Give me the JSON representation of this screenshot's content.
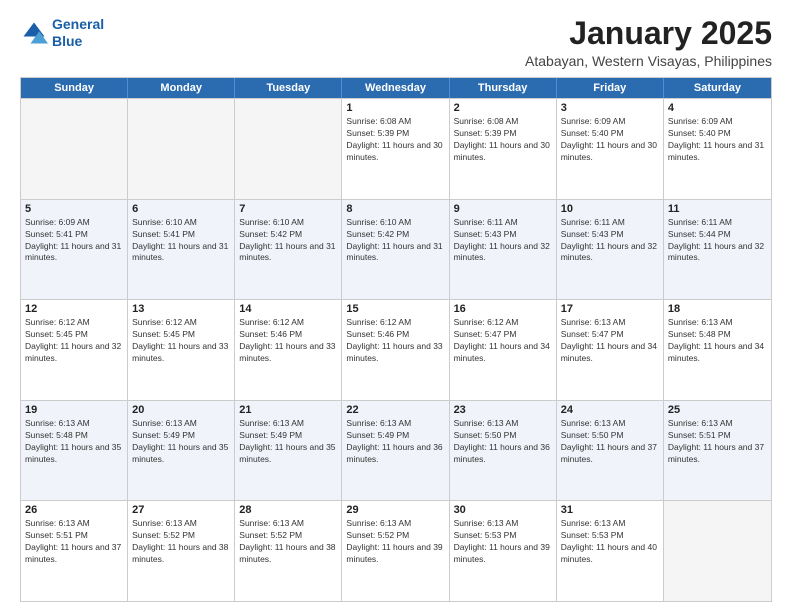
{
  "logo": {
    "line1": "General",
    "line2": "Blue"
  },
  "title": "January 2025",
  "subtitle": "Atabayan, Western Visayas, Philippines",
  "days": [
    "Sunday",
    "Monday",
    "Tuesday",
    "Wednesday",
    "Thursday",
    "Friday",
    "Saturday"
  ],
  "weeks": [
    [
      {
        "num": "",
        "empty": true
      },
      {
        "num": "",
        "empty": true
      },
      {
        "num": "",
        "empty": true
      },
      {
        "num": "1",
        "sunrise": "6:08 AM",
        "sunset": "5:39 PM",
        "daylight": "11 hours and 30 minutes."
      },
      {
        "num": "2",
        "sunrise": "6:08 AM",
        "sunset": "5:39 PM",
        "daylight": "11 hours and 30 minutes."
      },
      {
        "num": "3",
        "sunrise": "6:09 AM",
        "sunset": "5:40 PM",
        "daylight": "11 hours and 30 minutes."
      },
      {
        "num": "4",
        "sunrise": "6:09 AM",
        "sunset": "5:40 PM",
        "daylight": "11 hours and 31 minutes."
      }
    ],
    [
      {
        "num": "5",
        "sunrise": "6:09 AM",
        "sunset": "5:41 PM",
        "daylight": "11 hours and 31 minutes."
      },
      {
        "num": "6",
        "sunrise": "6:10 AM",
        "sunset": "5:41 PM",
        "daylight": "11 hours and 31 minutes."
      },
      {
        "num": "7",
        "sunrise": "6:10 AM",
        "sunset": "5:42 PM",
        "daylight": "11 hours and 31 minutes."
      },
      {
        "num": "8",
        "sunrise": "6:10 AM",
        "sunset": "5:42 PM",
        "daylight": "11 hours and 31 minutes."
      },
      {
        "num": "9",
        "sunrise": "6:11 AM",
        "sunset": "5:43 PM",
        "daylight": "11 hours and 32 minutes."
      },
      {
        "num": "10",
        "sunrise": "6:11 AM",
        "sunset": "5:43 PM",
        "daylight": "11 hours and 32 minutes."
      },
      {
        "num": "11",
        "sunrise": "6:11 AM",
        "sunset": "5:44 PM",
        "daylight": "11 hours and 32 minutes."
      }
    ],
    [
      {
        "num": "12",
        "sunrise": "6:12 AM",
        "sunset": "5:45 PM",
        "daylight": "11 hours and 32 minutes."
      },
      {
        "num": "13",
        "sunrise": "6:12 AM",
        "sunset": "5:45 PM",
        "daylight": "11 hours and 33 minutes."
      },
      {
        "num": "14",
        "sunrise": "6:12 AM",
        "sunset": "5:46 PM",
        "daylight": "11 hours and 33 minutes."
      },
      {
        "num": "15",
        "sunrise": "6:12 AM",
        "sunset": "5:46 PM",
        "daylight": "11 hours and 33 minutes."
      },
      {
        "num": "16",
        "sunrise": "6:12 AM",
        "sunset": "5:47 PM",
        "daylight": "11 hours and 34 minutes."
      },
      {
        "num": "17",
        "sunrise": "6:13 AM",
        "sunset": "5:47 PM",
        "daylight": "11 hours and 34 minutes."
      },
      {
        "num": "18",
        "sunrise": "6:13 AM",
        "sunset": "5:48 PM",
        "daylight": "11 hours and 34 minutes."
      }
    ],
    [
      {
        "num": "19",
        "sunrise": "6:13 AM",
        "sunset": "5:48 PM",
        "daylight": "11 hours and 35 minutes."
      },
      {
        "num": "20",
        "sunrise": "6:13 AM",
        "sunset": "5:49 PM",
        "daylight": "11 hours and 35 minutes."
      },
      {
        "num": "21",
        "sunrise": "6:13 AM",
        "sunset": "5:49 PM",
        "daylight": "11 hours and 35 minutes."
      },
      {
        "num": "22",
        "sunrise": "6:13 AM",
        "sunset": "5:49 PM",
        "daylight": "11 hours and 36 minutes."
      },
      {
        "num": "23",
        "sunrise": "6:13 AM",
        "sunset": "5:50 PM",
        "daylight": "11 hours and 36 minutes."
      },
      {
        "num": "24",
        "sunrise": "6:13 AM",
        "sunset": "5:50 PM",
        "daylight": "11 hours and 37 minutes."
      },
      {
        "num": "25",
        "sunrise": "6:13 AM",
        "sunset": "5:51 PM",
        "daylight": "11 hours and 37 minutes."
      }
    ],
    [
      {
        "num": "26",
        "sunrise": "6:13 AM",
        "sunset": "5:51 PM",
        "daylight": "11 hours and 37 minutes."
      },
      {
        "num": "27",
        "sunrise": "6:13 AM",
        "sunset": "5:52 PM",
        "daylight": "11 hours and 38 minutes."
      },
      {
        "num": "28",
        "sunrise": "6:13 AM",
        "sunset": "5:52 PM",
        "daylight": "11 hours and 38 minutes."
      },
      {
        "num": "29",
        "sunrise": "6:13 AM",
        "sunset": "5:52 PM",
        "daylight": "11 hours and 39 minutes."
      },
      {
        "num": "30",
        "sunrise": "6:13 AM",
        "sunset": "5:53 PM",
        "daylight": "11 hours and 39 minutes."
      },
      {
        "num": "31",
        "sunrise": "6:13 AM",
        "sunset": "5:53 PM",
        "daylight": "11 hours and 40 minutes."
      },
      {
        "num": "",
        "empty": true
      }
    ]
  ]
}
